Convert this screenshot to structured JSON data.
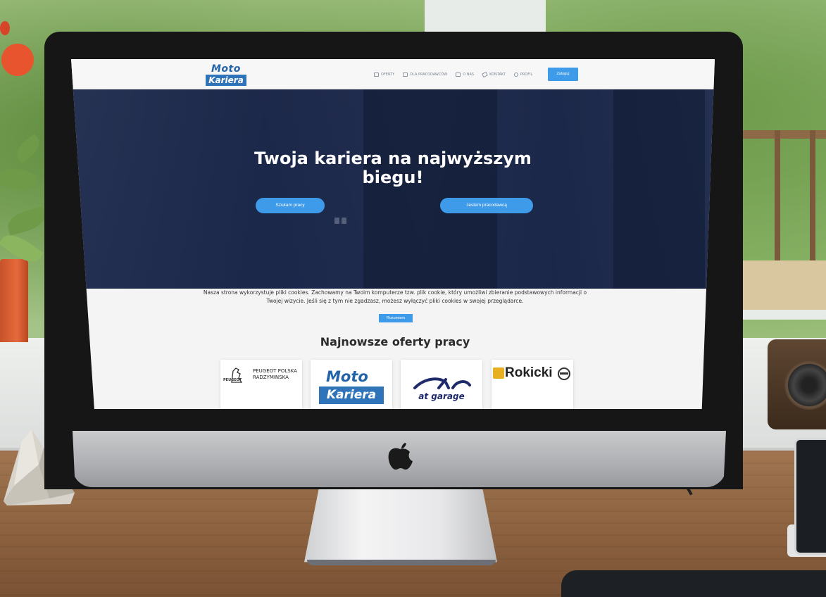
{
  "site": {
    "logo_top": "Moto",
    "logo_bottom": "Kariera"
  },
  "navbar": {
    "items": [
      {
        "label": "OFERTY",
        "icon": "briefcase-icon"
      },
      {
        "label": "DLA PRACODAWCÓW",
        "icon": "building-icon"
      },
      {
        "label": "O NAS",
        "icon": "id-card-icon"
      },
      {
        "label": "KONTAKT",
        "icon": "paper-plane-icon"
      },
      {
        "label": "PROFIL",
        "icon": "user-icon"
      }
    ],
    "login_label": "Zaloguj"
  },
  "hero": {
    "title": "Twoja kariera na najwyższym biegu!",
    "seek_job_label": "Szukam pracy",
    "employer_label": "Jestem pracodawcą"
  },
  "cookie_notice": {
    "text": "Nasza strona wykorzystuje pliki cookies. Zachowamy na Twoim komputerze tzw. plik cookie, który umożliwi zbieranie podstawowych informacji o Twojej wizycie. Jeśli się z tym nie zgadzasz, możesz wyłączyć pliki cookies w swojej przeglądarce.",
    "accept_label": "Rozumiem"
  },
  "offers": {
    "title": "Najnowsze oferty pracy",
    "cards": [
      {
        "company": "PEUGEOT POLSKA RADZYMINSKA",
        "brand": "PEUGEOT"
      },
      {
        "company_top": "Moto",
        "company_bottom": "Kariera"
      },
      {
        "company": "at garage"
      },
      {
        "company": "Rokicki"
      }
    ]
  },
  "colors": {
    "accent": "#3d9be9",
    "brand_blue": "#2f73b8",
    "hero_overlay": "#14234b"
  }
}
